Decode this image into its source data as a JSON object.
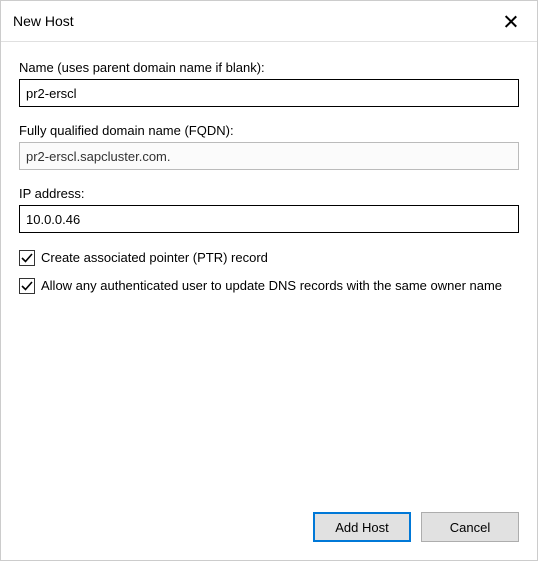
{
  "title": "New Host",
  "fields": {
    "name": {
      "label": "Name (uses parent domain name if blank):",
      "value": "pr2-erscl"
    },
    "fqdn": {
      "label": "Fully qualified domain name (FQDN):",
      "value": "pr2-erscl.sapcluster.com."
    },
    "ip": {
      "label": "IP address:",
      "value": "10.0.0.46"
    }
  },
  "checkboxes": {
    "ptr": {
      "label": "Create associated pointer (PTR) record",
      "checked": true
    },
    "allow_update": {
      "label": "Allow any authenticated user to update DNS records with the same owner name",
      "checked": true
    }
  },
  "buttons": {
    "add_host": "Add Host",
    "cancel": "Cancel"
  }
}
